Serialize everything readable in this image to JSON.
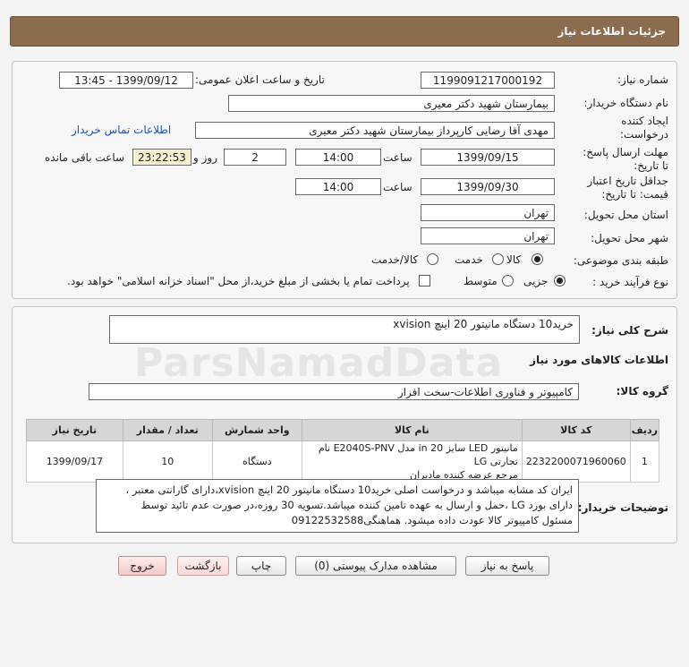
{
  "header": {
    "title": "جزئیات اطلاعات نیاز"
  },
  "form": {
    "need_number_label": "شماره نیاز:",
    "need_number": "1199091217000192",
    "announce_label": "تاریخ و ساعت اعلان عمومی:",
    "announce_value": "1399/09/12 - 13:45",
    "buyer_org_label": "نام دستگاه خریدار:",
    "buyer_org": "بیمارستان شهید دکتر معیری",
    "creator_label_1": "ایجاد کننده",
    "creator_label_2": "درخواست:",
    "creator": "مهدی  آقا رضایی کارپرداز بیمارستان شهید دکتر معیری",
    "contact_link": "اطلاعات تماس خریدار",
    "reply_deadline_label_1": "مهلت ارسال پاسخ:",
    "reply_deadline_label_2": "تا تاریخ:",
    "reply_date": "1399/09/15",
    "time_label": "ساعت",
    "reply_time": "14:00",
    "days_value": "2",
    "days_label": "روز و",
    "remaining_time": "23:22:53",
    "remaining_label": "ساعت باقی مانده",
    "validity_label_1": "جداقل تاریخ اعتبار",
    "validity_label_2": "قیمت: تا تاریخ:",
    "validity_date": "1399/09/30",
    "validity_time_label": "ساعت",
    "validity_time": "14:00",
    "province_label": "استان محل تحویل:",
    "province": "تهران",
    "city_label": "شهر محل تحویل:",
    "city": "تهران",
    "category_label": "طبقه بندی موضوعی:",
    "category_options": [
      "کالا",
      "خدمت",
      "کالا/خدمت"
    ],
    "process_label": "نوع فرآیند خرید :",
    "process_options": [
      "جزیی",
      "متوسط"
    ],
    "treasury_note": "پرداخت تمام یا بخشی از مبلغ خرید،از محل \"اسناد خزانه اسلامی\" خواهد بود."
  },
  "summary": {
    "label": "شرح کلی نیاز:",
    "value": "خرید10 دستگاه مانیتور 20 اینچ xvision"
  },
  "goods": {
    "section_title": "اطلاعات کالاهای مورد نیاز",
    "group_label": "گروه کالا:",
    "group_value": "کامپیوتر و فناوری اطلاعات-سخت افزار",
    "columns": [
      "ردیف",
      "کد کالا",
      "نام کالا",
      "واحد شمارش",
      "تعداد / مقدار",
      "تاریخ نیاز"
    ],
    "rows": [
      {
        "row": "1",
        "code": "2232200071960060",
        "name_line1": "مانیتور LED سایز 20 in مدل E2040S-PNV نام تجارتی LG",
        "name_line2": "مرجع عرضه کننده مادیران",
        "unit": "دستگاه",
        "qty": "10",
        "date": "1399/09/17"
      }
    ]
  },
  "buyer_notes": {
    "label": "توضیحات خریدار:",
    "line1": "ایران کد مشابه میباشد و درخواست اصلی خرید10 دستگاه مانیتور 20 اینچ xvision،دارای گارانتی معتبر ،",
    "line2": "دارای بورد LG ،حمل و ارسال به عهده تامین کننده میباشد.تسویه 30 روزه،در صورت عدم تائید توسط",
    "line3": "مسئول کامپیوتر کالا عودت داده میشود. هماهنگی09122532588"
  },
  "buttons": {
    "reply": "پاسخ به نیاز",
    "attachments": "مشاهده مدارک پیوستی (0)",
    "print": "چاپ",
    "back": "بازگشت",
    "exit": "خروج"
  },
  "watermark": {
    "text": "ParsNamadData"
  }
}
